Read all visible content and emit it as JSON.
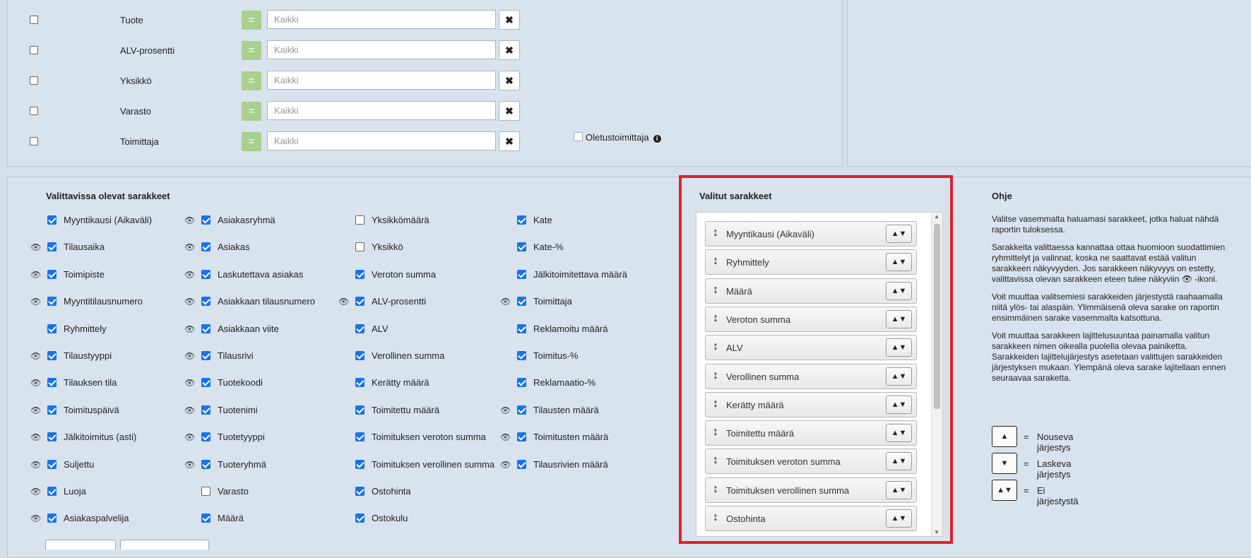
{
  "filters": [
    {
      "label": "Tuote",
      "placeholder": "Kaikki",
      "eq": "="
    },
    {
      "label": "ALV-prosentti",
      "placeholder": "Kaikki",
      "eq": "="
    },
    {
      "label": "Yksikkö",
      "placeholder": "Kaikki",
      "eq": "="
    },
    {
      "label": "Varasto",
      "placeholder": "Kaikki",
      "eq": "="
    },
    {
      "label": "Toimittaja",
      "placeholder": "Kaikki",
      "eq": "="
    }
  ],
  "clear_symbol": "✖",
  "default_supplier_label": "Oletustoimittaja",
  "info_icon": "i",
  "available": {
    "title": "Valittavissa olevat sarakkeet",
    "eye_symbol": "👁",
    "columns": [
      [
        {
          "label": "Myyntikausi (Aikaväli)",
          "checked": true,
          "eye": false
        },
        {
          "label": "Tilausaika",
          "checked": true,
          "eye": true
        },
        {
          "label": "Toimipiste",
          "checked": true,
          "eye": true
        },
        {
          "label": "Myyntitilausnumero",
          "checked": true,
          "eye": true
        },
        {
          "label": "Ryhmittely",
          "checked": true,
          "eye": false
        },
        {
          "label": "Tilaustyyppi",
          "checked": true,
          "eye": true
        },
        {
          "label": "Tilauksen tila",
          "checked": true,
          "eye": true
        },
        {
          "label": "Toimituspäivä",
          "checked": true,
          "eye": true
        },
        {
          "label": "Jälkitoimitus (asti)",
          "checked": true,
          "eye": true
        },
        {
          "label": "Suljettu",
          "checked": true,
          "eye": true
        },
        {
          "label": "Luoja",
          "checked": true,
          "eye": true
        },
        {
          "label": "Asiakaspalvelija",
          "checked": true,
          "eye": true
        }
      ],
      [
        {
          "label": "Asiakasryhmä",
          "checked": true,
          "eye": true
        },
        {
          "label": "Asiakas",
          "checked": true,
          "eye": true
        },
        {
          "label": "Laskutettava asiakas",
          "checked": true,
          "eye": true
        },
        {
          "label": "Asiakkaan tilausnumero",
          "checked": true,
          "eye": true
        },
        {
          "label": "Asiakkaan viite",
          "checked": true,
          "eye": true
        },
        {
          "label": "Tilausrivi",
          "checked": true,
          "eye": true
        },
        {
          "label": "Tuotekoodi",
          "checked": true,
          "eye": true
        },
        {
          "label": "Tuotenimi",
          "checked": true,
          "eye": true
        },
        {
          "label": "Tuotetyyppi",
          "checked": true,
          "eye": true
        },
        {
          "label": "Tuoteryhmä",
          "checked": true,
          "eye": true
        },
        {
          "label": "Varasto",
          "checked": false,
          "eye": false
        },
        {
          "label": "Määrä",
          "checked": true,
          "eye": false
        }
      ],
      [
        {
          "label": "Yksikkömäärä",
          "checked": false,
          "eye": false
        },
        {
          "label": "Yksikkö",
          "checked": false,
          "eye": false
        },
        {
          "label": "Veroton summa",
          "checked": true,
          "eye": false
        },
        {
          "label": "ALV-prosentti",
          "checked": true,
          "eye": true
        },
        {
          "label": "ALV",
          "checked": true,
          "eye": false
        },
        {
          "label": "Verollinen summa",
          "checked": true,
          "eye": false
        },
        {
          "label": "Kerätty määrä",
          "checked": true,
          "eye": false
        },
        {
          "label": "Toimitettu määrä",
          "checked": true,
          "eye": false
        },
        {
          "label": "Toimituksen veroton summa",
          "checked": true,
          "eye": false
        },
        {
          "label": "Toimituksen verollinen summa",
          "checked": true,
          "eye": false
        },
        {
          "label": "Ostohinta",
          "checked": true,
          "eye": false
        },
        {
          "label": "Ostokulu",
          "checked": true,
          "eye": false
        }
      ],
      [
        {
          "label": "Kate",
          "checked": true,
          "eye": false
        },
        {
          "label": "Kate-%",
          "checked": true,
          "eye": false
        },
        {
          "label": "Jälkitoimitettava määrä",
          "checked": true,
          "eye": false
        },
        {
          "label": "Toimittaja",
          "checked": true,
          "eye": true
        },
        {
          "label": "Reklamoitu määrä",
          "checked": true,
          "eye": false
        },
        {
          "label": "Toimitus-%",
          "checked": true,
          "eye": false
        },
        {
          "label": "Reklamaatio-%",
          "checked": true,
          "eye": false
        },
        {
          "label": "Tilausten määrä",
          "checked": true,
          "eye": true
        },
        {
          "label": "Toimitusten määrä",
          "checked": true,
          "eye": true
        },
        {
          "label": "Tilausrivien määrä",
          "checked": true,
          "eye": true
        }
      ]
    ]
  },
  "selected": {
    "title": "Valitut sarakkeet",
    "drag_symbol": "↕",
    "sort_symbol": "▲▼",
    "items": [
      "Myyntikausi (Aikaväli)",
      "Ryhmittely",
      "Määrä",
      "Veroton summa",
      "ALV",
      "Verollinen summa",
      "Kerätty määrä",
      "Toimitettu määrä",
      "Toimituksen veroton summa",
      "Toimituksen verollinen summa",
      "Ostohinta"
    ],
    "scroll_up": "▲",
    "scroll_down": "▼"
  },
  "help": {
    "title": "Ohje",
    "paragraphs": [
      "Valitse vasemmalta haluamasi sarakkeet, jotka haluat nähdä raportin tuloksessa.",
      "Sarakkeita valittaessa kannattaa ottaa huomioon suodattimien ryhmittelyt ja valinnat, koska ne saattavat estää valitun sarakkeen näkyvyyden. Jos sarakkeen näkyvyys on estetty, valittavissa olevan sarakkeen eteen tulee näkyviin 👁 -ikoni.",
      "Voit muuttaa valitsemiesi sarakkeiden järjestystä raahaamalla niitä ylös- tai alaspäin. Ylimmäisenä oleva sarake on raportin ensimmäinen sarake vasemmalta katsottuna.",
      "Voit muuttaa sarakkeen lajittelusuuntaa painamalla valitun sarakkeen nimen oikealla puolella olevaa painiketta. Sarakkeiden lajittelujärjestys asetetaan valittujen sarakkeiden järjestyksen mukaan. Ylempänä oleva sarake lajitellaan ennen seuraavaa saraketta."
    ],
    "legend": [
      {
        "symbol": "▲",
        "eq": "=",
        "label": "Nouseva järjestys"
      },
      {
        "symbol": "▼",
        "eq": "=",
        "label": "Laskeva järjestys"
      },
      {
        "symbol": "▲▼",
        "eq": "=",
        "label": "Ei järjestystä"
      }
    ]
  }
}
